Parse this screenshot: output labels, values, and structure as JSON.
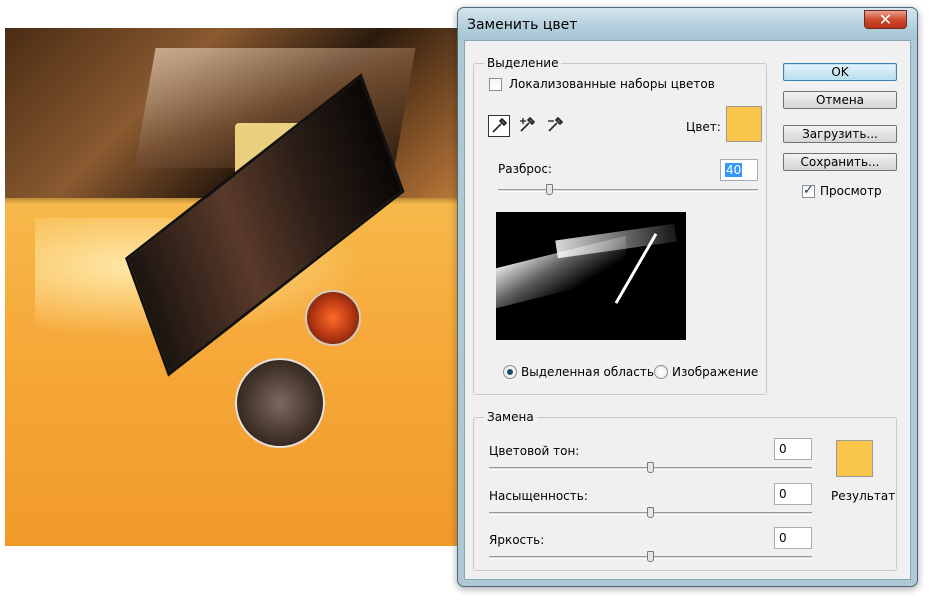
{
  "dialog": {
    "title": "Заменить цвет",
    "close_glyph": "✕"
  },
  "selection": {
    "group_label": "Выделение",
    "localized_clusters_label": "Локализованные наборы цветов",
    "localized_clusters_checked": false,
    "color_label": "Цвет:",
    "color_value": "#f9c54a",
    "fuzziness_label": "Разброс:",
    "fuzziness_value": "40",
    "fuzziness_slider_fraction": 0.2,
    "tools": [
      "eyedropper-icon",
      "eyedropper-plus-icon",
      "eyedropper-minus-icon"
    ],
    "radio_selection_label": "Выделенная область",
    "radio_image_label": "Изображение",
    "selected_view": "selection"
  },
  "replacement": {
    "group_label": "Замена",
    "hue_label": "Цветовой тон:",
    "hue_value": "0",
    "saturation_label": "Насыщенность:",
    "saturation_value": "0",
    "lightness_label": "Яркость:",
    "lightness_value": "0",
    "result_label": "Результат",
    "result_color": "#f9c54a"
  },
  "buttons": {
    "ok": "OK",
    "cancel": "Отмена",
    "load": "Загрузить...",
    "save": "Сохранить..."
  },
  "preview_option": {
    "label": "Просмотр",
    "checked": true
  }
}
